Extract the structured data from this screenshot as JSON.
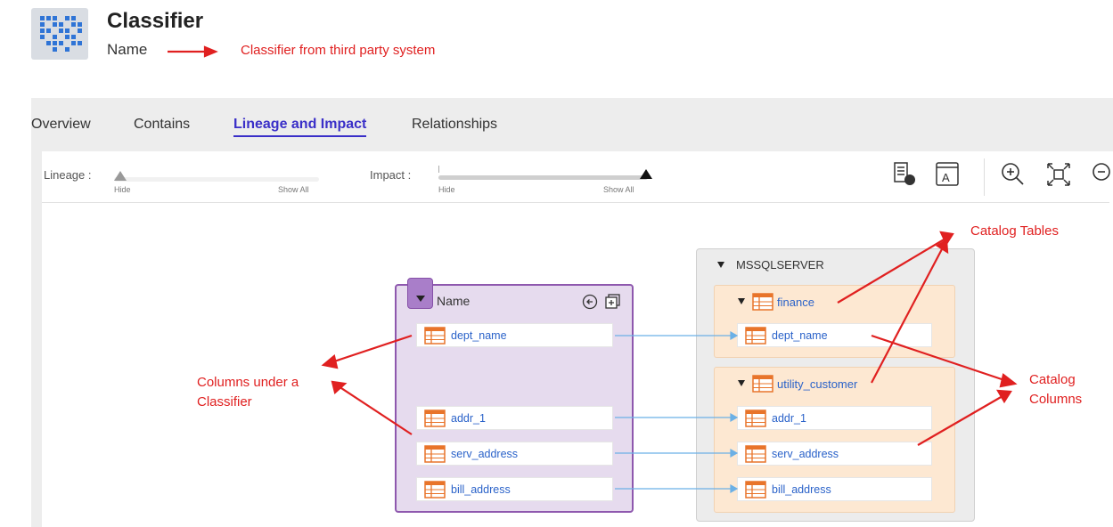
{
  "header": {
    "title": "Classifier",
    "subtitle": "Name"
  },
  "tabs": [
    {
      "label": "Overview",
      "active": false
    },
    {
      "label": "Contains",
      "active": false
    },
    {
      "label": "Lineage and Impact",
      "active": true
    },
    {
      "label": "Relationships",
      "active": false
    }
  ],
  "sliders": {
    "lineage": {
      "label": "Lineage :",
      "min_label": "Hide",
      "max_label": "Show All",
      "value": 0
    },
    "impact": {
      "label": "Impact :",
      "min_label": "Hide",
      "max_label": "Show All",
      "value": 1
    }
  },
  "toolbar_icons": [
    "table-detail-icon",
    "text-label-icon",
    "zoom-in-icon",
    "fit-to-screen-icon",
    "zoom-out-icon"
  ],
  "classifier": {
    "title": "Name",
    "columns": [
      "dept_name",
      "addr_1",
      "serv_address",
      "bill_address"
    ]
  },
  "server": {
    "name": "MSSQLSERVER",
    "tables": [
      {
        "name": "finance",
        "columns": [
          "dept_name"
        ]
      },
      {
        "name": "utility_customer",
        "columns": [
          "addr_1",
          "serv_address",
          "bill_address"
        ]
      }
    ]
  },
  "annotations": {
    "classifier_note": "Classifier from third party system",
    "catalog_tables": "Catalog Tables",
    "columns_under_line1": "Columns under a",
    "columns_under_line2": "Classifier",
    "catalog_columns_line1": "Catalog",
    "catalog_columns_line2": "Columns"
  },
  "colors": {
    "active_tab": "#3a2fc8",
    "annotation": "#e02020",
    "classifier_fill": "#e6dbee",
    "classifier_border": "#8e58ae",
    "table_fill": "#fde8d2",
    "link_text": "#2a62c9",
    "table_icon": "#e8742a",
    "lineage_line": "#6bb0e6"
  }
}
